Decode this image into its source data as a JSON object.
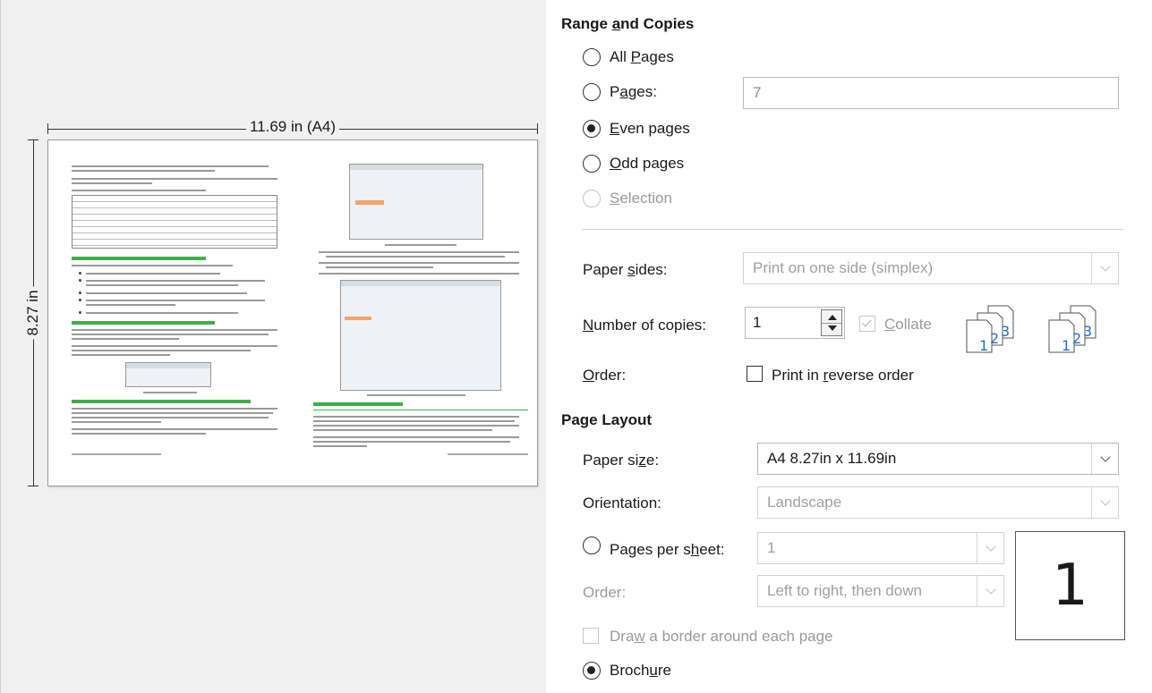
{
  "preview": {
    "width_label": "11.69 in (A4)",
    "height_label": "8.27 in",
    "left_page_heading_1": "Selecting general printing options",
    "left_page_heading_2": "Selecting printer and print options",
    "left_page_heading_3": "Printing multiple pages on a single sheet of paper",
    "right_page_heading": "Digital signing of documents"
  },
  "range": {
    "title_pre": "Range ",
    "title_key": "a",
    "title_post": "nd Copies",
    "all_pages": {
      "pre": "All ",
      "key": "P",
      "post": "ages"
    },
    "pages": {
      "pre": "P",
      "key": "a",
      "post": "ges:",
      "value": "7"
    },
    "even_pages": {
      "pre": "",
      "key": "E",
      "post": "ven pages"
    },
    "odd_pages": {
      "pre": "",
      "key": "O",
      "post": "dd pages"
    },
    "selection": {
      "pre": "",
      "key": "S",
      "post": "election"
    },
    "selected": "even_pages"
  },
  "copies": {
    "paper_sides_label": {
      "pre": "Paper ",
      "key": "s",
      "post": "ides:"
    },
    "paper_sides_value": "Print on one side (simplex)",
    "number_label": {
      "pre": "",
      "key": "N",
      "post": "umber of copies:"
    },
    "number_value": "1",
    "collate": {
      "pre": "",
      "key": "C",
      "post": "ollate"
    },
    "collate_checked": true,
    "order_label": {
      "pre": "",
      "key": "O",
      "post": "rder:"
    },
    "reverse": {
      "pre": "Print in ",
      "key": "r",
      "post": "everse order"
    },
    "reverse_checked": false
  },
  "layout": {
    "title": "Page Layout",
    "paper_size_label": {
      "pre": "Paper si",
      "key": "z",
      "post": "e:"
    },
    "paper_size_value": "A4 8.27in x 11.69in",
    "orientation_label": "Orientation:",
    "orientation_value": "Landscape",
    "pages_per_sheet_label": {
      "pre": "Pages per s",
      "key": "h",
      "post": "eet:"
    },
    "pages_per_sheet_value": "1",
    "order_label": "Order:",
    "order_value": "Left to right, then down",
    "border": {
      "pre": "Dra",
      "key": "w",
      "post": " a border around each page"
    },
    "brochure": {
      "pre": "Broch",
      "key": "u",
      "post": "re"
    },
    "pps_preview_number": "1",
    "selected": "brochure"
  }
}
